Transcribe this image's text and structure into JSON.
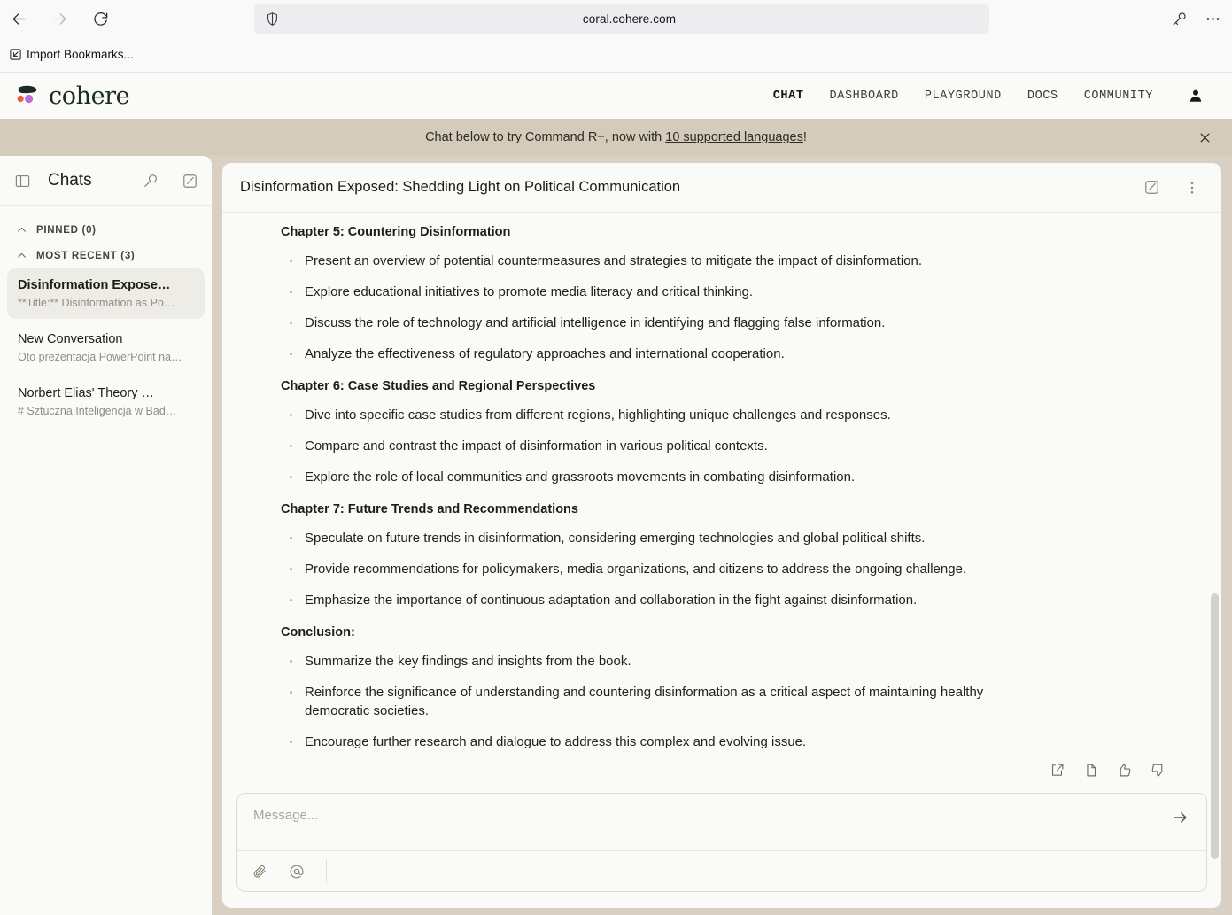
{
  "browser": {
    "back_label": "Back",
    "forward_label": "Forward",
    "reload_label": "Reload",
    "shield_label": "Tracking protection",
    "url": "coral.cohere.com",
    "key_icon_label": "Saved logins",
    "menu_label": "Open application menu",
    "bookmark_label": "Import Bookmarks..."
  },
  "site": {
    "logo_text": "cohere",
    "nav": [
      {
        "label": "CHAT",
        "active": true
      },
      {
        "label": "DASHBOARD",
        "active": false
      },
      {
        "label": "PLAYGROUND",
        "active": false
      },
      {
        "label": "DOCS",
        "active": false
      },
      {
        "label": "COMMUNITY",
        "active": false
      }
    ],
    "banner": {
      "prefix": "Chat below to try Command R+, now with ",
      "link": "10 supported languages",
      "suffix": "!",
      "close_label": "×"
    },
    "colors": {
      "banner_bg": "#d4cbbb",
      "page_bg": "#d8d0c3",
      "panel_bg": "#fafaf8",
      "active_chat_bg": "#eeece6",
      "logo_green": "#1b2b22",
      "logo_orange": "#e8603c",
      "logo_purple": "#c06be0"
    }
  },
  "sidebar": {
    "title": "Chats",
    "toggle_label": "Collapse sidebar",
    "search_label": "Search chats",
    "new_chat_label": "New chat",
    "groups": [
      {
        "label": "PINNED (0)",
        "expanded": true,
        "items": []
      },
      {
        "label": "MOST RECENT (3)",
        "expanded": true,
        "items": [
          {
            "title": "Disinformation Expose…",
            "preview": "**Title:** Disinformation as Po…",
            "active": true
          },
          {
            "title": "New Conversation",
            "preview": "Oto prezentacja PowerPoint na…",
            "active": false
          },
          {
            "title": "Norbert Elias' Theory …",
            "preview": "# Sztuczna Inteligencja w Bad…",
            "active": false
          }
        ]
      }
    ]
  },
  "conversation": {
    "title": "Disinformation Exposed: Shedding Light on Political Communication",
    "edit_label": "Edit title",
    "menu_label": "More options",
    "sections": [
      {
        "heading": "Chapter 5: Countering Disinformation",
        "bullets": [
          "Present an overview of potential countermeasures and strategies to mitigate the impact of disinformation.",
          "Explore educational initiatives to promote media literacy and critical thinking.",
          "Discuss the role of technology and artificial intelligence in identifying and flagging false information.",
          "Analyze the effectiveness of regulatory approaches and international cooperation."
        ]
      },
      {
        "heading": "Chapter 6: Case Studies and Regional Perspectives",
        "bullets": [
          "Dive into specific case studies from different regions, highlighting unique challenges and responses.",
          "Compare and contrast the impact of disinformation in various political contexts.",
          "Explore the role of local communities and grassroots movements in combating disinformation."
        ]
      },
      {
        "heading": "Chapter 7: Future Trends and Recommendations",
        "bullets": [
          "Speculate on future trends in disinformation, considering emerging technologies and global political shifts.",
          "Provide recommendations for policymakers, media organizations, and citizens to address the ongoing challenge.",
          "Emphasize the importance of continuous adaptation and collaboration in the fight against disinformation."
        ]
      },
      {
        "heading": "Conclusion:",
        "bullets": [
          "Summarize the key findings and insights from the book.",
          "Reinforce the significance of understanding and countering disinformation as a critical aspect of maintaining healthy democratic societies.",
          "Encourage further research and dialogue to address this complex and evolving issue."
        ]
      }
    ],
    "message_actions": [
      {
        "name": "share-icon",
        "label": "Share"
      },
      {
        "name": "copy-icon",
        "label": "Copy"
      },
      {
        "name": "thumbs-up-icon",
        "label": "Good response"
      },
      {
        "name": "thumbs-down-icon",
        "label": "Bad response"
      }
    ]
  },
  "composer": {
    "placeholder": "Message...",
    "value": "",
    "attach_label": "Attach file",
    "mention_label": "Mention a tool",
    "send_label": "Send message"
  }
}
